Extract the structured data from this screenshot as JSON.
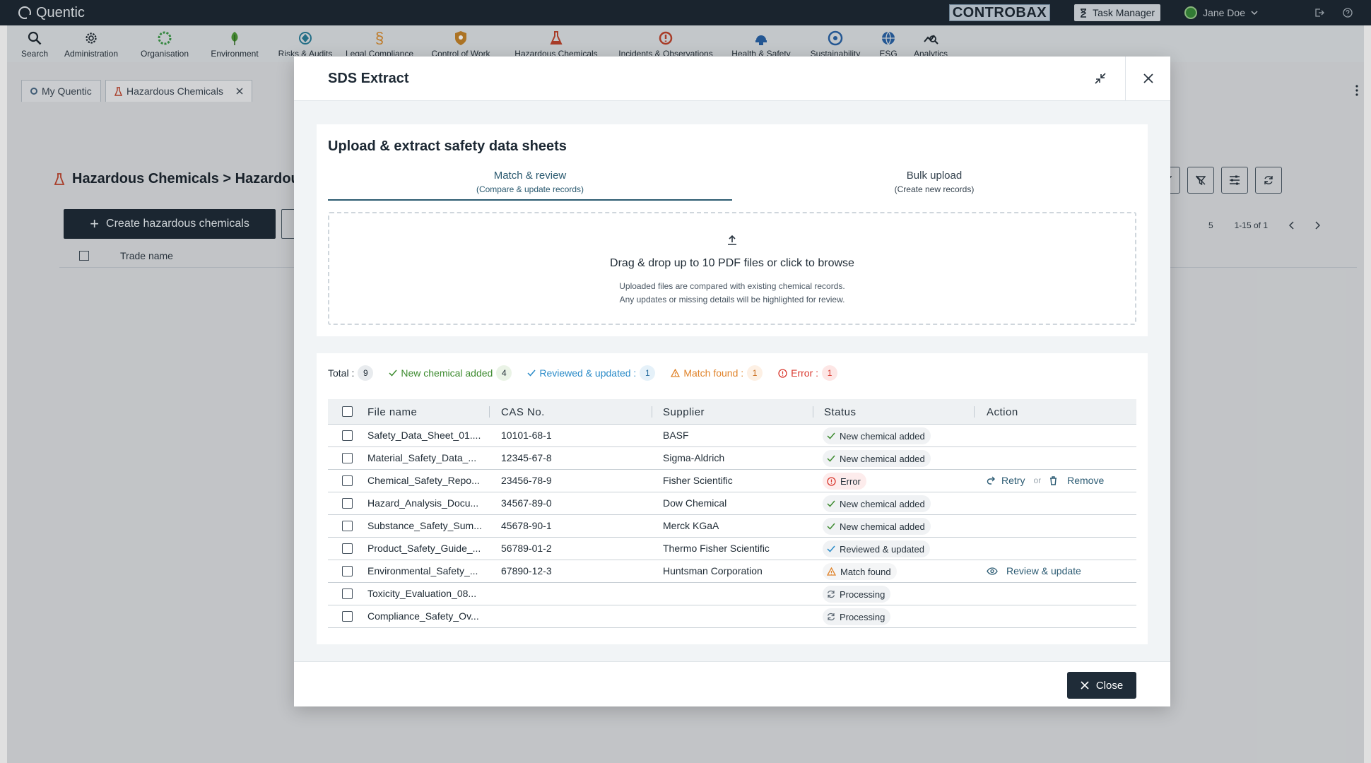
{
  "app": {
    "name": "Quentic"
  },
  "topbar": {
    "controbax_label": "CONTROBAX",
    "task_manager_label": "Task Manager",
    "user_name": "Jane Doe"
  },
  "modules": [
    {
      "label": "Search",
      "icon": "search-icon",
      "color": "#1f2a33"
    },
    {
      "label": "Administration",
      "icon": "gear-icon",
      "color": "#1f2a33"
    },
    {
      "label": "Organisation",
      "icon": "organisation-icon",
      "color": "#3c9a48"
    },
    {
      "label": "Environment",
      "icon": "tree-icon",
      "color": "#4e9a3a"
    },
    {
      "label": "Risks & Audits",
      "icon": "risk-icon",
      "color": "#2a7f9a"
    },
    {
      "label": "Legal Compliance",
      "icon": "paragraph-icon",
      "color": "#d98a2b"
    },
    {
      "label": "Control of Work",
      "icon": "shield-icon",
      "color": "#c4832a"
    },
    {
      "label": "Hazardous Chemicals",
      "icon": "flask-icon",
      "color": "#c0452e"
    },
    {
      "label": "Incidents & Observations",
      "icon": "alert-icon",
      "color": "#c0452e"
    },
    {
      "label": "Health & Safety",
      "icon": "helmet-icon",
      "color": "#2a64a8"
    },
    {
      "label": "Sustainability",
      "icon": "sustainability-icon",
      "color": "#2a64a8"
    },
    {
      "label": "ESG",
      "icon": "globe-icon",
      "color": "#2a64a8"
    },
    {
      "label": "Analytics",
      "icon": "analytics-icon",
      "color": "#1f2a33"
    }
  ],
  "tabs": [
    {
      "label": "My Quentic"
    },
    {
      "label": "Hazardous Chemicals"
    }
  ],
  "background": {
    "title": "Hazardous Chemicals > Hazardous Ch",
    "create_button": "Create hazardous chemicals",
    "column_trade_name": "Trade name",
    "pager_text": "1-15 of 1",
    "page_size": "5"
  },
  "modal": {
    "title": "SDS Extract",
    "upload_title": "Upload & extract safety data sheets",
    "tabs": [
      {
        "label": "Match & review",
        "sub": "(Compare & update records)",
        "active": true
      },
      {
        "label": "Bulk upload",
        "sub": "(Create new records)",
        "active": false
      }
    ],
    "dropzone": {
      "main": "Drag & drop up to 10 PDF files or click to browse",
      "sub1": "Uploaded files are compared with existing chemical records.",
      "sub2": "Any updates or missing details will be highlighted for review."
    },
    "summary": {
      "total_label": "Total :",
      "total_count": "9",
      "new_label": "New chemical added",
      "new_count": "4",
      "reviewed_label": "Reviewed & updated :",
      "reviewed_count": "1",
      "match_label": "Match found :",
      "match_count": "1",
      "error_label": "Error :",
      "error_count": "1"
    },
    "columns": {
      "file": "File name",
      "cas": "CAS No.",
      "supplier": "Supplier",
      "status": "Status",
      "action": "Action"
    },
    "rows": [
      {
        "file": "Safety_Data_Sheet_01....",
        "cas": "10101-68-1",
        "supplier": "BASF",
        "status": "New chemical added",
        "kind": "new"
      },
      {
        "file": "Material_Safety_Data_...",
        "cas": "12345-67-8",
        "supplier": "Sigma-Aldrich",
        "status": "New chemical added",
        "kind": "new"
      },
      {
        "file": "Chemical_Safety_Repo...",
        "cas": "23456-78-9",
        "supplier": "Fisher Scientific",
        "status": "Error",
        "kind": "error"
      },
      {
        "file": "Hazard_Analysis_Docu...",
        "cas": "34567-89-0",
        "supplier": "Dow Chemical",
        "status": "New chemical added",
        "kind": "new"
      },
      {
        "file": "Substance_Safety_Sum...",
        "cas": "45678-90-1",
        "supplier": "Merck KGaA",
        "status": "New chemical added",
        "kind": "new"
      },
      {
        "file": "Product_Safety_Guide_...",
        "cas": "56789-01-2",
        "supplier": "Thermo Fisher Scientific",
        "status": "Reviewed & updated",
        "kind": "reviewed"
      },
      {
        "file": "Environmental_Safety_...",
        "cas": "67890-12-3",
        "supplier": "Huntsman Corporation",
        "status": "Match found",
        "kind": "match"
      },
      {
        "file": "Toxicity_Evaluation_08...",
        "cas": "",
        "supplier": "",
        "status": "Processing",
        "kind": "processing"
      },
      {
        "file": "Compliance_Safety_Ov...",
        "cas": "",
        "supplier": "",
        "status": "Processing",
        "kind": "processing"
      }
    ],
    "actions": {
      "retry": "Retry",
      "or": "or",
      "remove": "Remove",
      "review_update": "Review & update"
    },
    "close_label": "Close"
  },
  "colors": {
    "accent": "#2b5a70",
    "success": "#3d8b2f",
    "info": "#2a8bc8",
    "warning": "#e0832a",
    "error": "#d9382e",
    "dark_button": "#1f2c38"
  }
}
